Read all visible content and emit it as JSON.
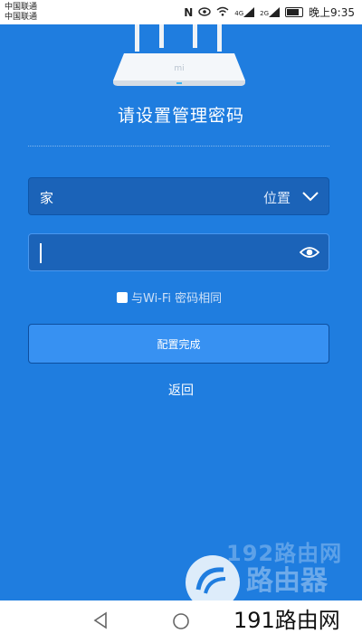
{
  "status_bar": {
    "carrier_1": "中国联通",
    "carrier_2": "中国联通",
    "signal_1_tag": "4G",
    "signal_2_tag": "2G",
    "time": "晚上9:35"
  },
  "page": {
    "title": "请设置管理密码",
    "location_value": "家",
    "location_label": "位置",
    "password_value": "",
    "same_as_wifi_label": "与Wi-Fi 密码相同",
    "same_as_wifi_checked": false,
    "submit_label": "配置完成",
    "back_label": "返回"
  },
  "watermark": {
    "line_1": "192路由网",
    "line_2": "路由器",
    "line_3": "191路由网"
  },
  "router_brand": "mi",
  "colors": {
    "background": "#1f7ddf",
    "button": "#3791f2",
    "field": "#1b63b8"
  }
}
